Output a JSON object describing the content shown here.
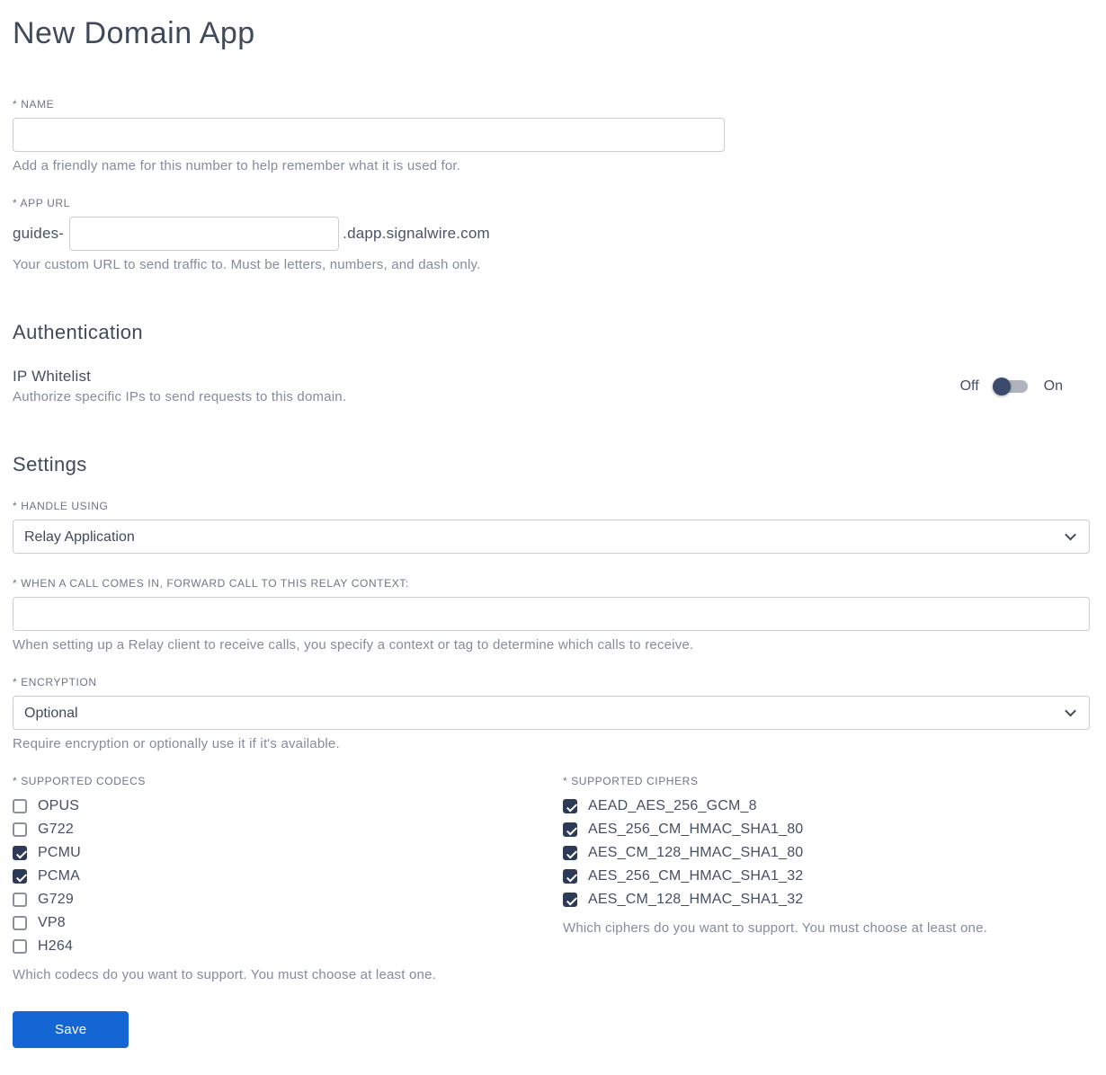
{
  "page": {
    "title": "New Domain App"
  },
  "fields": {
    "name": {
      "label": "* NAME",
      "value": "",
      "help": "Add a friendly name for this number to help remember what it is used for."
    },
    "app_url": {
      "label": "* APP URL",
      "prefix": "guides-",
      "value": "",
      "suffix": ".dapp.signalwire.com",
      "help": "Your custom URL to send traffic to. Must be letters, numbers, and dash only."
    }
  },
  "authentication": {
    "heading": "Authentication",
    "ip_whitelist": {
      "label": "IP Whitelist",
      "help": "Authorize specific IPs to send requests to this domain.",
      "off_label": "Off",
      "on_label": "On",
      "state": "off"
    }
  },
  "settings": {
    "heading": "Settings",
    "handle_using": {
      "label": "* HANDLE USING",
      "value": "Relay Application"
    },
    "relay_context": {
      "label": "* WHEN A CALL COMES IN, FORWARD CALL TO THIS RELAY CONTEXT:",
      "value": "",
      "help": "When setting up a Relay client to receive calls, you specify a context or tag to determine which calls to receive."
    },
    "encryption": {
      "label": "* ENCRYPTION",
      "value": "Optional",
      "help": "Require encryption or optionally use it if it's available."
    },
    "codecs": {
      "label": "* SUPPORTED CODECS",
      "items": [
        {
          "label": "OPUS",
          "checked": false
        },
        {
          "label": "G722",
          "checked": false
        },
        {
          "label": "PCMU",
          "checked": true
        },
        {
          "label": "PCMA",
          "checked": true
        },
        {
          "label": "G729",
          "checked": false
        },
        {
          "label": "VP8",
          "checked": false
        },
        {
          "label": "H264",
          "checked": false
        }
      ],
      "help": "Which codecs do you want to support. You must choose at least one."
    },
    "ciphers": {
      "label": "* SUPPORTED CIPHERS",
      "items": [
        {
          "label": "AEAD_AES_256_GCM_8",
          "checked": true
        },
        {
          "label": "AES_256_CM_HMAC_SHA1_80",
          "checked": true
        },
        {
          "label": "AES_CM_128_HMAC_SHA1_80",
          "checked": true
        },
        {
          "label": "AES_256_CM_HMAC_SHA1_32",
          "checked": true
        },
        {
          "label": "AES_CM_128_HMAC_SHA1_32",
          "checked": true
        }
      ],
      "help": "Which ciphers do you want to support. You must choose at least one."
    }
  },
  "actions": {
    "save_label": "Save"
  },
  "colors": {
    "accent": "#1566d5",
    "navy": "#2d3a57",
    "heading": "#3f4a5a",
    "label": "#6e7584",
    "help": "#838b9c",
    "border": "#c9cdd6"
  }
}
